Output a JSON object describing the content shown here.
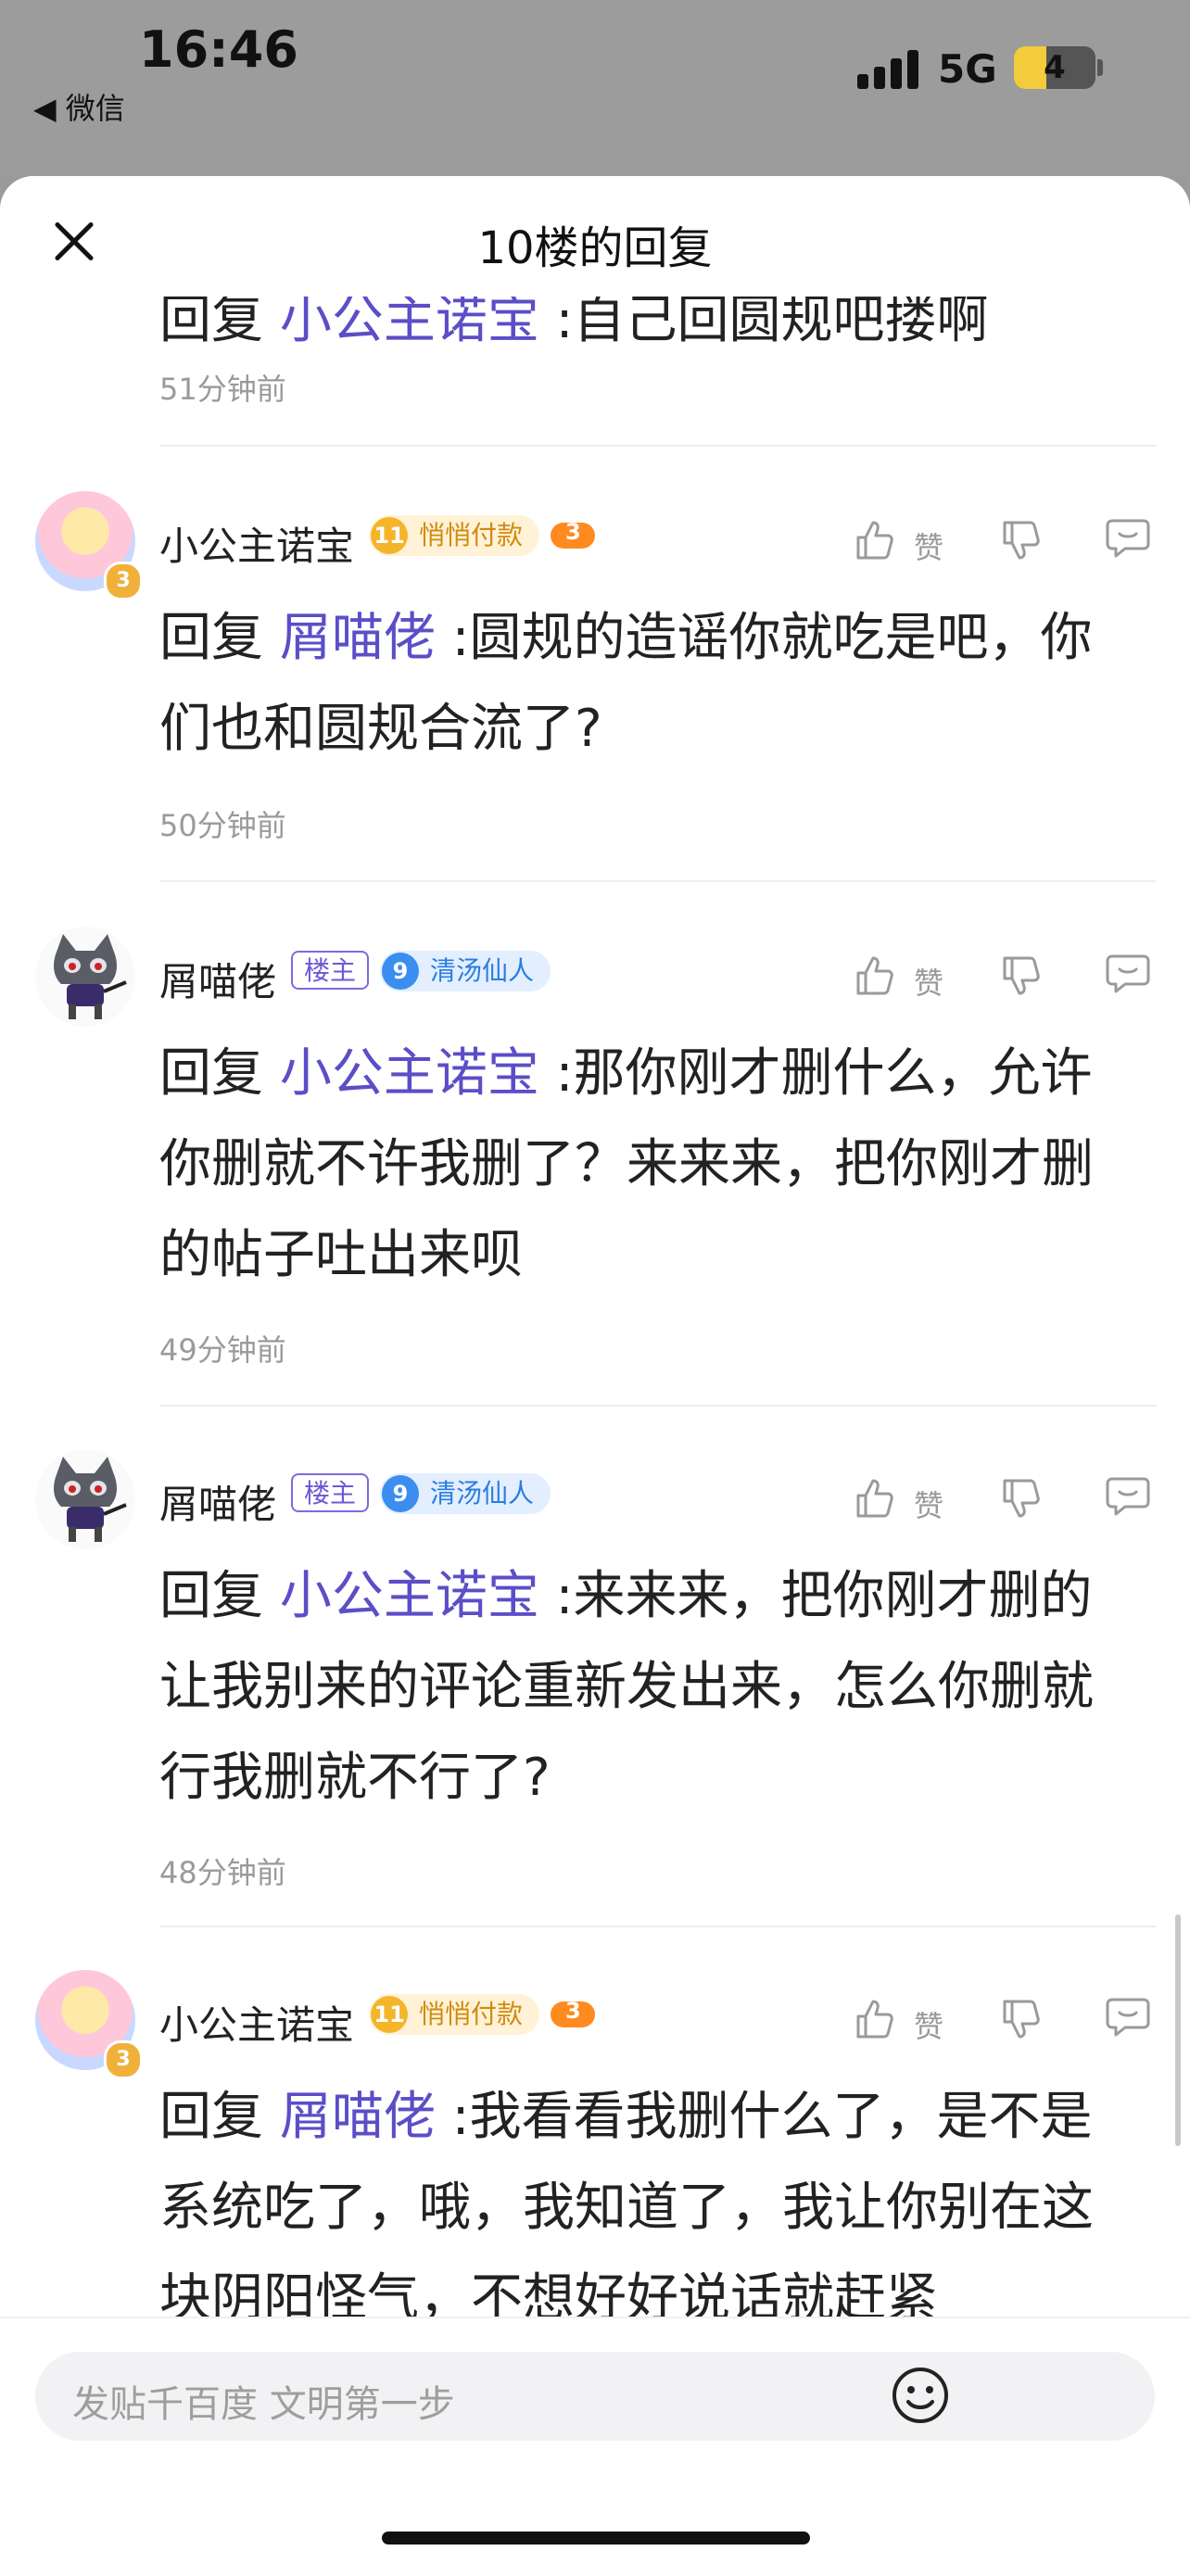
{
  "status_bar": {
    "time": "16:46",
    "back_app": "◀ 微信",
    "network": "5G",
    "battery_level": "4",
    "battery_fraction": 0.4
  },
  "sheet": {
    "title": "10楼的回复"
  },
  "partial_comment": {
    "prefix": "回复 ",
    "reply_to": "小公主诺宝",
    "text": " :自己回圆规吧搂啊",
    "time": "51分钟前"
  },
  "actions": {
    "like_label": "赞"
  },
  "comments": [
    {
      "author": "小公主诺宝",
      "avatar_badge": "3",
      "level": "11",
      "title": "悄悄付款",
      "pad_level": "3",
      "prefix": "回复 ",
      "reply_to": "屑喵佬",
      "text": " :圆规的造谣你就吃是吧，你们也和圆规合流了?",
      "time": "50分钟前"
    },
    {
      "author": "屑喵佬",
      "owner_badge": "楼主",
      "level": "9",
      "title": "清汤仙人",
      "prefix": "回复 ",
      "reply_to": "小公主诺宝",
      "text": " :那你刚才删什么，允许你删就不许我删了？来来来，把你刚才删的帖子吐出来呗",
      "time": "49分钟前"
    },
    {
      "author": "屑喵佬",
      "owner_badge": "楼主",
      "level": "9",
      "title": "清汤仙人",
      "prefix": "回复 ",
      "reply_to": "小公主诺宝",
      "text": " :来来来，把你刚才删的让我别来的评论重新发出来，怎么你删就行我删就不行了?",
      "time": "48分钟前"
    },
    {
      "author": "小公主诺宝",
      "avatar_badge": "3",
      "level": "11",
      "title": "悄悄付款",
      "pad_level": "3",
      "prefix": "回复 ",
      "reply_to": "屑喵佬",
      "text": " :我看看我删什么了，是不是系统吃了，哦，我知道了，我让你别在这块阴阳怪气，不想好好说话就赶紧"
    }
  ],
  "input": {
    "placeholder": "发贴千百度 文明第一步"
  },
  "colors": {
    "name_link": "#5b4ec7",
    "gold_badge": "#f4b52a",
    "blue_badge": "#3b8ef0",
    "owner_badge": "#7a6be0"
  }
}
